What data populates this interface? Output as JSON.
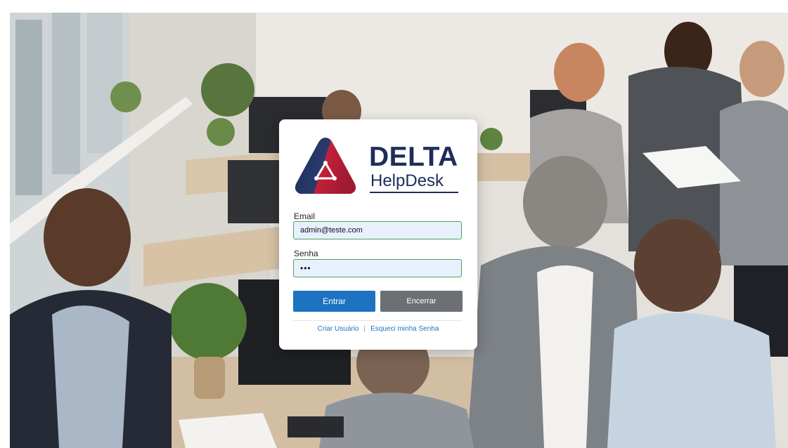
{
  "brand": {
    "title": "DELTA",
    "subtitle": "HelpDesk"
  },
  "colors": {
    "brand_navy": "#1d2e5b",
    "brand_red": "#c4213a",
    "primary": "#1e73c0",
    "secondary": "#6c6f73",
    "input_border": "#4aa35c",
    "input_fill": "#e8f0fe"
  },
  "login": {
    "email_label": "Email",
    "email_value": "admin@teste.com",
    "password_label": "Senha",
    "password_value": "•••",
    "submit_label": "Entrar",
    "close_label": "Encerrar",
    "create_user_link": "Criar Usuário",
    "link_separator": "|",
    "forgot_password_link": "Esqueci minha Senha"
  }
}
